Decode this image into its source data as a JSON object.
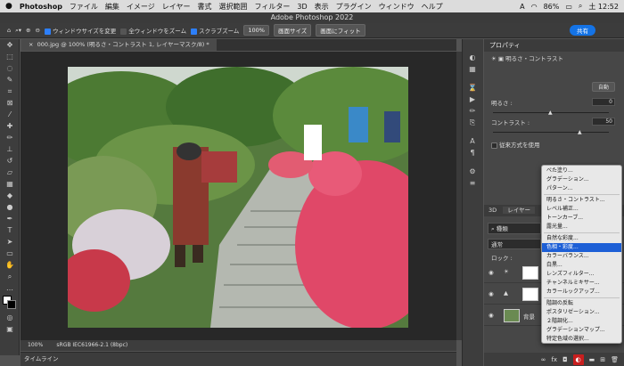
{
  "menubar": {
    "apple": "",
    "app": "Photoshop",
    "items": [
      "ファイル",
      "編集",
      "イメージ",
      "レイヤー",
      "書式",
      "選択範囲",
      "フィルター",
      "3D",
      "表示",
      "プラグイン",
      "ウィンドウ",
      "ヘルプ"
    ],
    "clock": "土 12:52",
    "battery": "86%",
    "input": "A"
  },
  "window": {
    "title": "Adobe Photoshop 2022"
  },
  "options": {
    "resize_windows": "ウィンドウサイズを変更",
    "all_windows": "全ウィンドウをズーム",
    "scrubby": "スクラブズーム",
    "zoom": "100%",
    "fit_screen": "画面サイズ",
    "fill_screen": "画面にフィット",
    "share": "共有"
  },
  "doc_tab": {
    "title": "000.jpg @ 100% (明るさ・コントラスト 1, レイヤーマスク/8) *"
  },
  "status": {
    "zoom": "100%",
    "profile": "sRGB IEC61966-2.1 (8bpc)"
  },
  "timeline": {
    "label": "タイムライン"
  },
  "properties": {
    "tab": "プロパティ",
    "adjustment": "明るさ・コントラスト",
    "auto": "自動",
    "brightness_label": "明るさ :",
    "brightness_value": "0",
    "contrast_label": "コントラスト :",
    "contrast_value": "50",
    "legacy": "従来方式を使用"
  },
  "layers": {
    "tab3d": "3D",
    "tab_layers": "レイヤー",
    "tab_ch": "チ",
    "search": "種類",
    "blend": "通常",
    "lock": "ロック :",
    "bg_name": "背景"
  },
  "menu": {
    "groups": [
      [
        "べた塗り...",
        "グラデーション...",
        "パターン..."
      ],
      [
        "明るさ・コントラスト...",
        "レベル補正...",
        "トーンカーブ...",
        "露光量..."
      ],
      [
        "自然な彩度...",
        "色相・彩度...",
        "カラーバランス...",
        "白黒...",
        "レンズフィルター...",
        "チャンネルミキサー...",
        "カラールックアップ..."
      ],
      [
        "階調の反転",
        "ポスタリゼーション...",
        "２階調化...",
        "グラデーションマップ...",
        "特定色域の選択..."
      ]
    ],
    "highlighted": "色相・彩度..."
  },
  "colors": {
    "accent": "#1473e6",
    "highlight": "#1d5fd6",
    "adj_button": "#c81e1e"
  }
}
